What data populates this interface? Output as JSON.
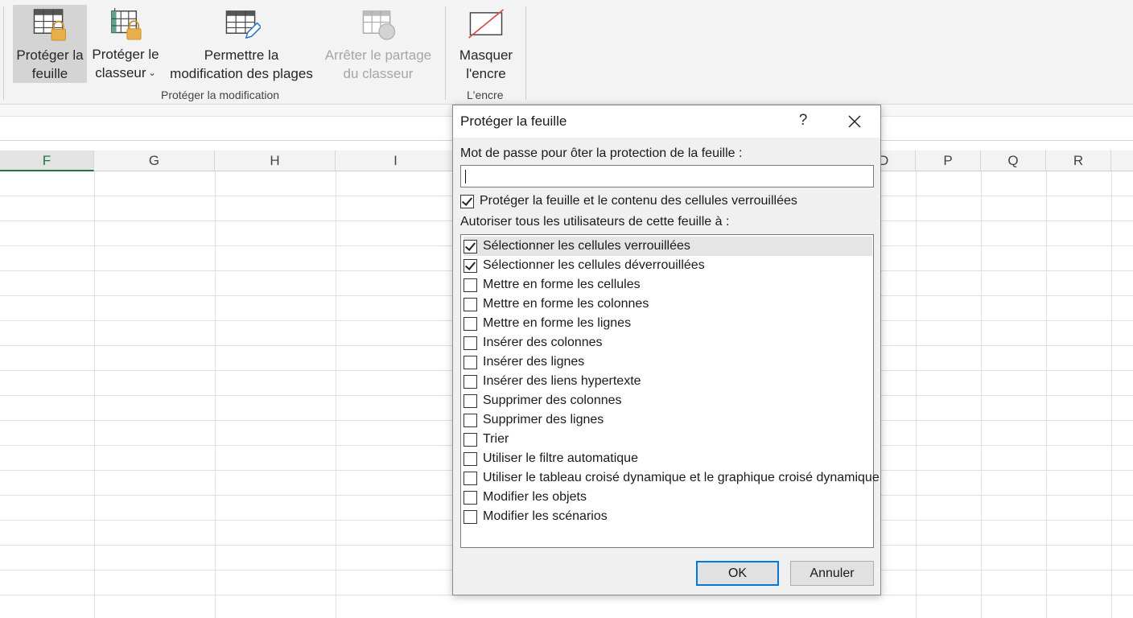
{
  "ribbon": {
    "buttons": [
      {
        "id": "protect-sheet",
        "label": "Protéger la\nfeuille",
        "selected": true,
        "disabled": false
      },
      {
        "id": "protect-workbook",
        "label": "Protéger le\nclasseur",
        "has_dropdown": true,
        "disabled": false
      },
      {
        "id": "allow-edit-ranges",
        "label": "Permettre la\nmodification des plages",
        "disabled": false
      },
      {
        "id": "unshare-workbook",
        "label": "Arrêter le partage\ndu classeur",
        "disabled": true
      },
      {
        "id": "hide-ink",
        "label": "Masquer\nl'encre",
        "disabled": false
      }
    ],
    "groups": {
      "protect": "Protéger la modification",
      "ink": "L'encre"
    },
    "chevron": "⌄"
  },
  "grid": {
    "columns_left": [
      "F",
      "G",
      "H",
      "I"
    ],
    "columns_right": [
      "D",
      "P",
      "Q",
      "R"
    ],
    "active_column": "F"
  },
  "dialog": {
    "title": "Protéger la feuille",
    "help": "?",
    "password_label": "Mot de passe pour ôter la protection de la feuille :",
    "password_value": "",
    "protect_checkbox": {
      "label": "Protéger la feuille et le contenu des cellules verrouillées",
      "checked": true
    },
    "allow_label": "Autoriser tous les utilisateurs de cette feuille à :",
    "permissions": [
      {
        "label": "Sélectionner les cellules verrouillées",
        "checked": true
      },
      {
        "label": "Sélectionner les cellules déverrouillées",
        "checked": true
      },
      {
        "label": "Mettre en forme les cellules",
        "checked": false
      },
      {
        "label": "Mettre en forme les colonnes",
        "checked": false
      },
      {
        "label": "Mettre en forme les lignes",
        "checked": false
      },
      {
        "label": "Insérer des colonnes",
        "checked": false
      },
      {
        "label": "Insérer des lignes",
        "checked": false
      },
      {
        "label": "Insérer des liens hypertexte",
        "checked": false
      },
      {
        "label": "Supprimer des colonnes",
        "checked": false
      },
      {
        "label": "Supprimer des lignes",
        "checked": false
      },
      {
        "label": "Trier",
        "checked": false
      },
      {
        "label": "Utiliser le filtre automatique",
        "checked": false
      },
      {
        "label": "Utiliser le tableau croisé dynamique et le graphique croisé dynamique",
        "checked": false
      },
      {
        "label": "Modifier les objets",
        "checked": false
      },
      {
        "label": "Modifier les scénarios",
        "checked": false
      }
    ],
    "ok_label": "OK",
    "cancel_label": "Annuler"
  },
  "colors": {
    "accent_green": "#217346",
    "focus_blue": "#0078d7",
    "lock_gold": "#e8b04a"
  }
}
